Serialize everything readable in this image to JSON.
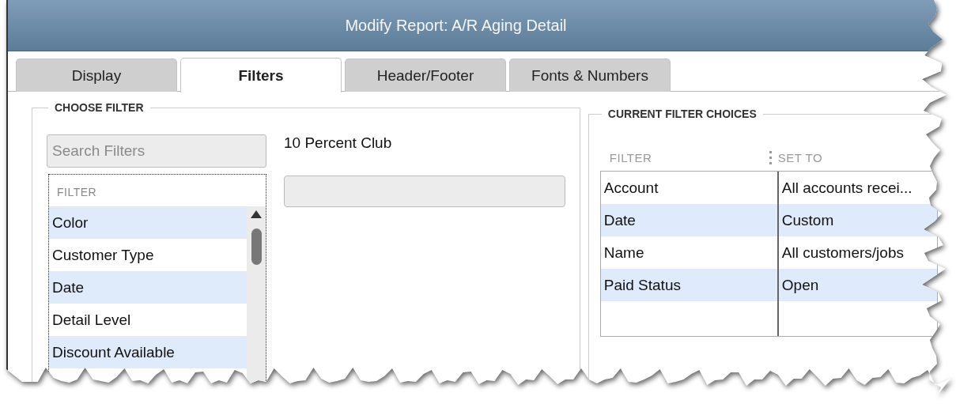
{
  "window": {
    "title": "Modify Report: A/R Aging Detail"
  },
  "tabs": [
    {
      "label": "Display",
      "selected": false
    },
    {
      "label": "Filters",
      "selected": true
    },
    {
      "label": "Header/Footer",
      "selected": false
    },
    {
      "label": "Fonts & Numbers",
      "selected": false
    }
  ],
  "choose_filter": {
    "title": "CHOOSE FILTER",
    "search": {
      "placeholder": "Search Filters"
    },
    "list_header": "FILTER",
    "items": [
      "Color",
      "Customer Type",
      "Date",
      "Detail Level",
      "Discount Available"
    ],
    "selected_filter": {
      "label": "10 Percent Club"
    }
  },
  "current_filter_choices": {
    "title": "CURRENT FILTER CHOICES",
    "columns": [
      "FILTER",
      "SET TO"
    ],
    "rows": [
      {
        "filter": "Account",
        "set_to": "All accounts recei..."
      },
      {
        "filter": "Date",
        "set_to": "Custom"
      },
      {
        "filter": "Name",
        "set_to": "All customers/jobs"
      },
      {
        "filter": "Paid Status",
        "set_to": "Open"
      }
    ]
  }
}
